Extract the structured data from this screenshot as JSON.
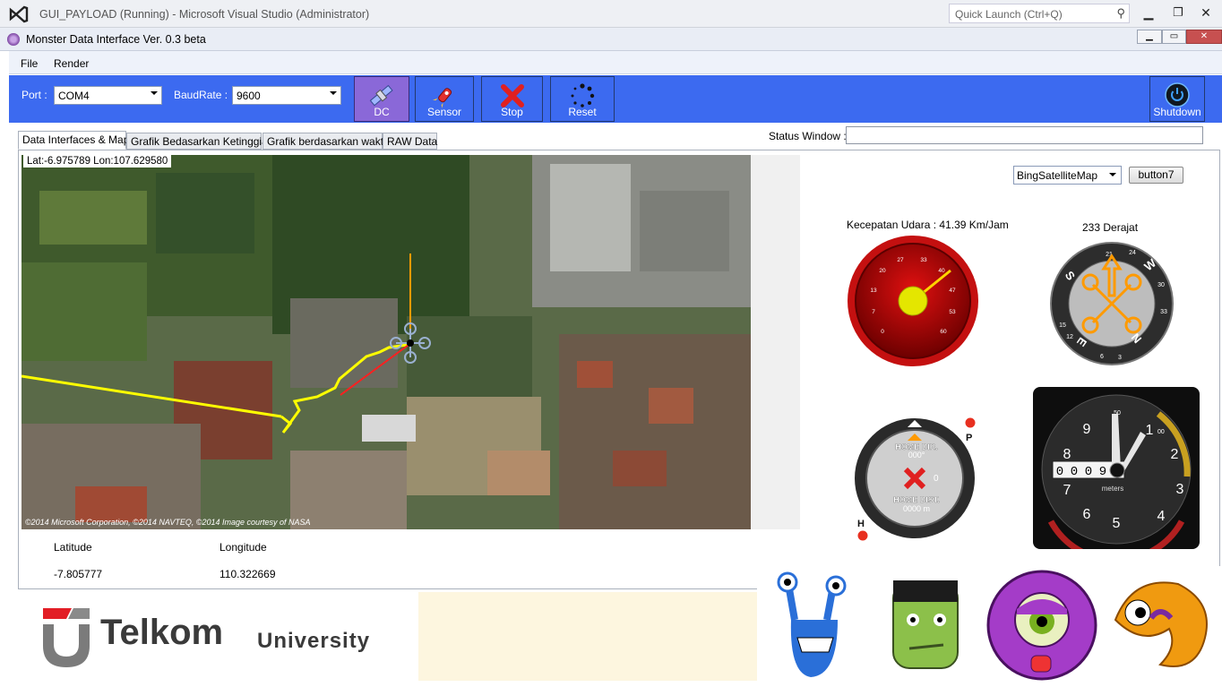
{
  "vs_window": {
    "title": "GUI_PAYLOAD (Running) - Microsoft Visual Studio (Administrator)",
    "quick_launch_placeholder": "Quick Launch (Ctrl+Q)"
  },
  "app": {
    "title": "Monster Data Interface Ver. 0.3 beta"
  },
  "menu": [
    "File",
    "Render"
  ],
  "toolbar": {
    "port_label": "Port :",
    "port_value": "COM4",
    "baud_label": "BaudRate :",
    "baud_value": "9600",
    "buttons": [
      {
        "label": "DC",
        "icon": "satellite-icon"
      },
      {
        "label": "Sensor",
        "icon": "rocket-icon"
      },
      {
        "label": "Stop",
        "icon": "stop-x-icon"
      },
      {
        "label": "Reset",
        "icon": "reset-spinner-icon"
      }
    ],
    "shutdown_label": "Shutdown"
  },
  "tabs": [
    "Data Interfaces & Map",
    "Grafik Bedasarkan Ketinggian",
    "Grafik berdasarkan waktu",
    "RAW Data"
  ],
  "status": {
    "label": "Status Window :",
    "value": ""
  },
  "map": {
    "readout": "Lat:-6.975789 Lon:107.629580",
    "copyright": "©2014 Microsoft Corporation, ©2014 NAVTEQ, ©2014 Image courtesy of NASA",
    "provider": "BingSatelliteMap"
  },
  "coords": {
    "lat_label": "Latitude",
    "lat_value": "-7.805777",
    "lon_label": "Longitude",
    "lon_value": "110.322669"
  },
  "button7_label": "button7",
  "airspeed": {
    "label": "Kecepatan Udara :  41.39 Km/Jam",
    "ticks": [
      "0",
      "7",
      "13",
      "20",
      "27",
      "33",
      "40",
      "47",
      "53",
      "60"
    ]
  },
  "heading": {
    "label": "233 Derajat",
    "letters": [
      "N",
      "E",
      "S",
      "W"
    ],
    "numbers": [
      "3",
      "6",
      "12",
      "15",
      "21",
      "24",
      "30",
      "33"
    ]
  },
  "home_indicator": {
    "title": "HOME DIR.",
    "dir_value": "000°",
    "dist_title": "HOME DIST.",
    "dist_value": "0000  m",
    "center_value": "0",
    "p_label": "P",
    "h_label": "H"
  },
  "altimeter": {
    "numbers": [
      "0",
      "1",
      "2",
      "3",
      "4",
      "5",
      "6",
      "7",
      "8",
      "9"
    ],
    "small_labels": [
      "50",
      "00"
    ],
    "counter": [
      "0",
      "0",
      "0",
      "9",
      "9"
    ],
    "unit": "meters"
  },
  "logo": {
    "brand": "Telkom",
    "suffix": "University",
    "accent": "#e21e26"
  },
  "colors": {
    "toolbar_bg": "#3c6af0",
    "track_yellow": "#ffff00",
    "track_red": "#ff2020",
    "heading_orange": "#ff9a00"
  }
}
